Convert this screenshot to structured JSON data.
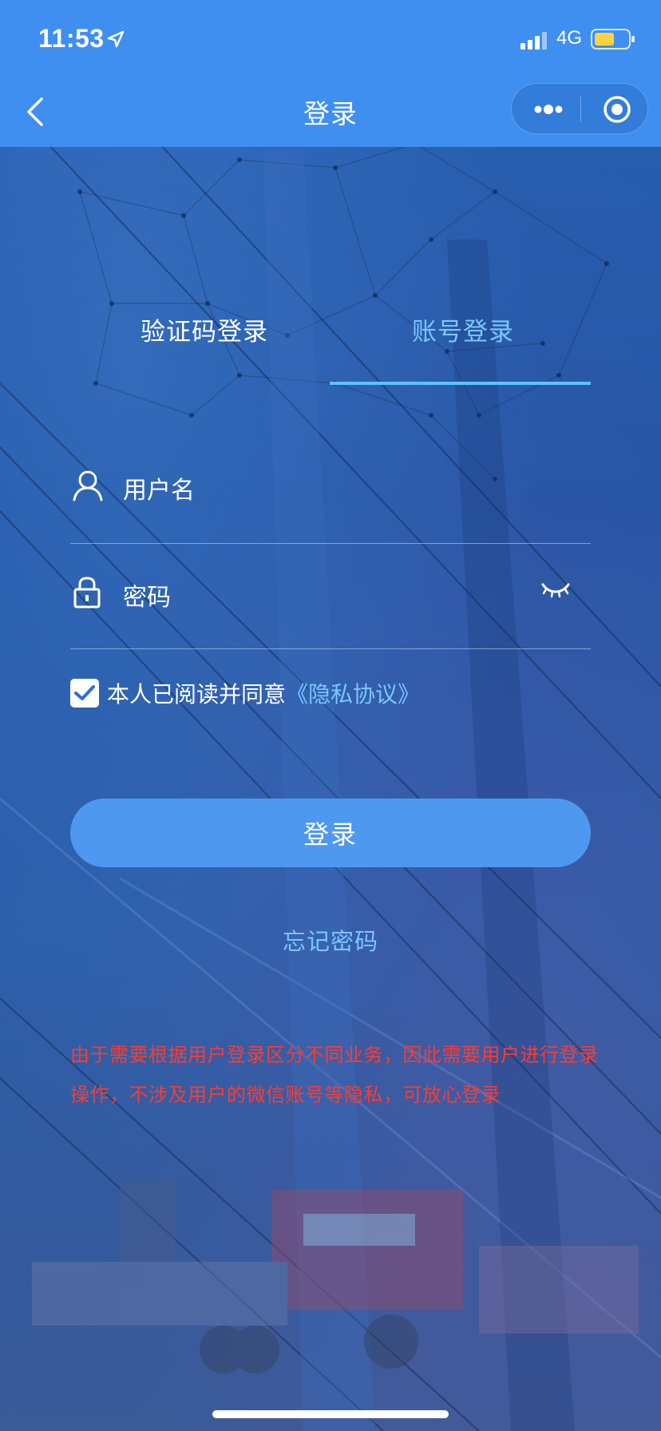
{
  "status_bar": {
    "time": "11:53",
    "network": "4G"
  },
  "nav": {
    "title": "登录"
  },
  "tabs": [
    {
      "label": "验证码登录",
      "active": false
    },
    {
      "label": "账号登录",
      "active": true
    }
  ],
  "form": {
    "username_placeholder": "用户名",
    "password_placeholder": "密码",
    "agree_checked": true,
    "agree_text": "本人已阅读并同意",
    "privacy_link": "《隐私协议》",
    "login_label": "登录",
    "forgot_label": "忘记密码"
  },
  "notice": "由于需要根据用户登录区分不同业务，因此需要用户进行登录操作，不涉及用户的微信账号等隐私，可放心登录",
  "colors": {
    "nav_bg": "#3f8ff0",
    "accent": "#7ac6ff",
    "button": "#4e98f0",
    "notice": "#ff3b2f",
    "battery": "#ffd23f"
  }
}
